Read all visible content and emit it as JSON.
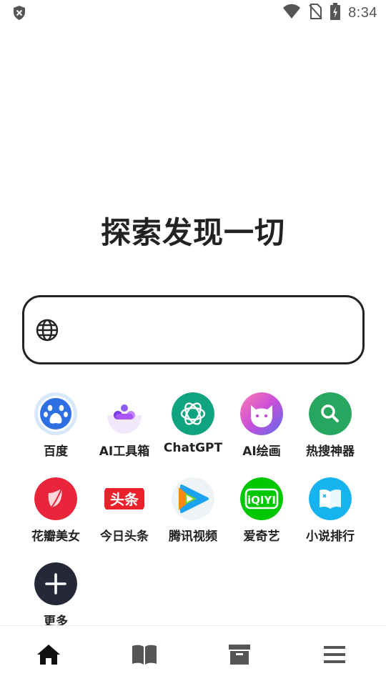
{
  "status_bar": {
    "time": "8:34",
    "icons": [
      "shield-x-icon",
      "wifi-icon",
      "no-sim-icon",
      "battery-charging-icon"
    ]
  },
  "headline": "探索发现一切",
  "search": {
    "icon": "globe-icon",
    "value": "",
    "placeholder": ""
  },
  "apps": [
    {
      "label": "百度",
      "icon": "baidu-paw-icon",
      "color": "#2f6fe4"
    },
    {
      "label": "AI工具箱",
      "icon": "ai-toolbox-icon",
      "color": "#8b5cf6"
    },
    {
      "label": "ChatGPT",
      "icon": "chatgpt-icon",
      "color": "#10a37f"
    },
    {
      "label": "AI绘画",
      "icon": "ai-paint-cat-icon",
      "color": "#c84fd8"
    },
    {
      "label": "热搜神器",
      "icon": "search-magnifier-icon",
      "color": "#27a660"
    },
    {
      "label": "花瓣美女",
      "icon": "petal-icon",
      "color": "#e8253b"
    },
    {
      "label": "今日头条",
      "icon": "toutiao-icon",
      "color": "#e8212b"
    },
    {
      "label": "腾讯视频",
      "icon": "tencent-video-icon",
      "color": "#1aa3f0"
    },
    {
      "label": "爱奇艺",
      "icon": "iqiyi-icon",
      "color": "#00c800"
    },
    {
      "label": "小说排行",
      "icon": "book-icon",
      "color": "#16b3ee"
    },
    {
      "label": "更多",
      "icon": "plus-icon",
      "color": "#252838"
    }
  ],
  "bottom_nav": {
    "items": [
      {
        "icon": "home-icon",
        "active": true
      },
      {
        "icon": "open-book-icon",
        "active": false
      },
      {
        "icon": "archive-box-icon",
        "active": false
      },
      {
        "icon": "menu-icon",
        "active": false
      }
    ]
  }
}
